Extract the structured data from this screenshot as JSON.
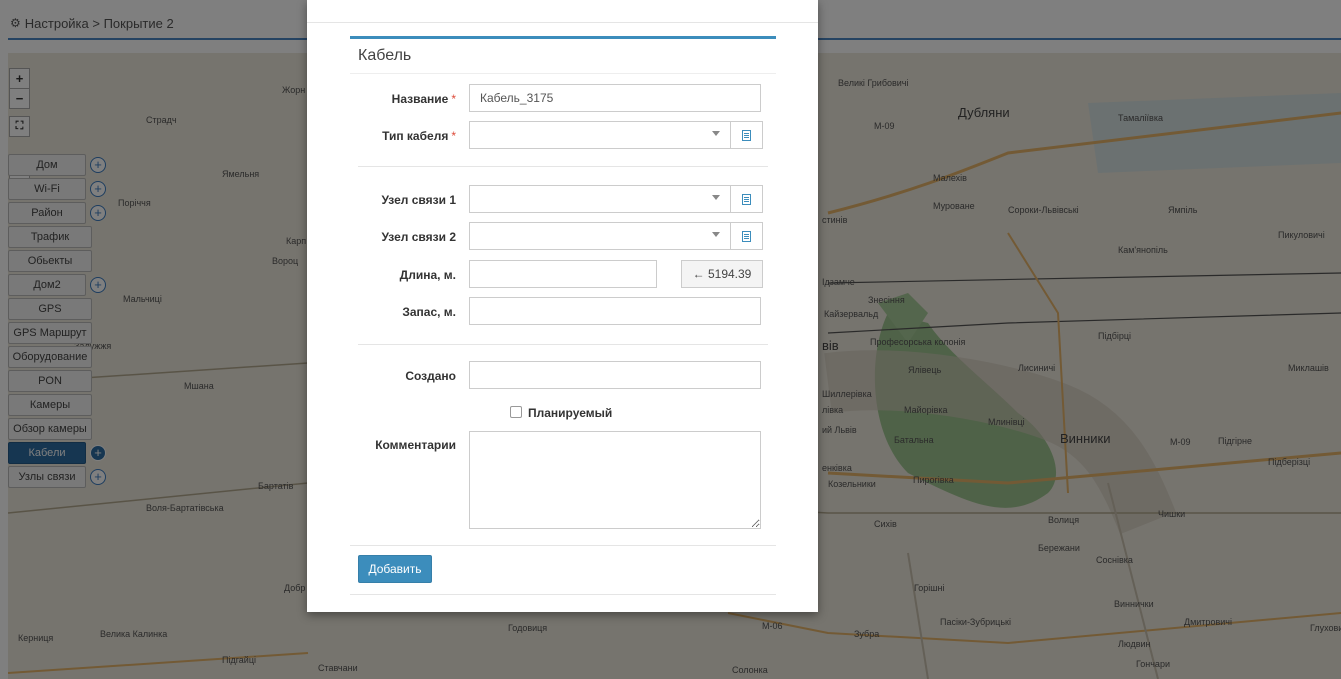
{
  "topbar": {
    "breadcrumb": "Настройка > Покрытие 2"
  },
  "map": {
    "zoom_in": "+",
    "zoom_out": "−",
    "fullscreen": "⛶",
    "collapse": "−",
    "labels": {
      "dublyany": "Дубляни",
      "velyki_hrybovychi": "Великі Грибовичі",
      "tamalivka": "Тамаліївка",
      "m09_top": "М-09",
      "malekhiv": "Малехів",
      "murovane": "Муроване",
      "soroky": "Сороки-Львівські",
      "yampil": "Ямпіль",
      "pykulovychi": "Пикуловичі",
      "kamianopil": "Кам'янопіль",
      "rudamche": "Ідзамче",
      "znesinnia": "Знесіння",
      "kaizervald": "Кайзервальд",
      "profesorska": "Професорська колонія",
      "pidbirtsi": "Підбірці",
      "lysynychi": "Лисиничі",
      "mykolaiv": "Миклашів",
      "yalivets": "Ялівець",
      "shilerivka": "Шиллерівка",
      "mayorivka": "Майорівка",
      "mlynivtsi": "Млинівці",
      "batalna": "Батальна",
      "vynnyky": "Винники",
      "m09": "М-09",
      "pidhirne": "Підгірне",
      "pidberiztsi": "Підберізці",
      "kozelnyky": "Козельники",
      "pyrohivka": "Пирогівка",
      "chyshky": "Чишки",
      "volytsia": "Волиця",
      "sykhiv": "Сихів",
      "berezhany": "Бережани",
      "sosnivka": "Соснівка",
      "horishni": "Горішні",
      "vynnychky": "Виннички",
      "dmytrovychi": "Дмитровичі",
      "pasiky": "Пасіки-Зубрицькі",
      "zubra": "Зубра",
      "liudvyn": "Людвин",
      "honchary": "Гончари",
      "hlukhovychi": "Глухови",
      "stradch": "Страдч",
      "yamelnia": "Ямельня",
      "porichchia": "Поріччя",
      "mylchytsi": "Мальчиці",
      "zaluzhzhia": "Залужжя",
      "mshana": "Мшана",
      "bartativ": "Бартатів",
      "volia_bartativska": "Воля-Бартатівська",
      "kernytsia": "Керниця",
      "velyka_kalynka": "Велика Калинка",
      "pidhaitsi": "Підгайці",
      "stavchany": "Ставчани",
      "hodovytsia": "Годовиця",
      "m06": "М-06",
      "solonka": "Солонка",
      "zhorny": "Жорн",
      "stinyv": "стинів",
      "vis": "вів",
      "livka": "лівка",
      "lviv": "ий Львів",
      "nkivka": "енківка",
      "karpa": "Карп",
      "voroptsi": "Вороц",
      "dobr": "Добр"
    }
  },
  "layers": [
    {
      "label": "Дом",
      "plus": true,
      "active": false
    },
    {
      "label": "Wi-Fi",
      "plus": true,
      "active": false
    },
    {
      "label": "Район",
      "plus": true,
      "active": false
    },
    {
      "label": "Трафик",
      "plus": false,
      "active": false
    },
    {
      "label": "Обьекты",
      "plus": false,
      "active": false
    },
    {
      "label": "Дом2",
      "plus": true,
      "active": false
    },
    {
      "label": "GPS",
      "plus": false,
      "active": false
    },
    {
      "label": "GPS Маршрут",
      "plus": false,
      "active": false
    },
    {
      "label": "Оборудование",
      "plus": false,
      "active": false
    },
    {
      "label": "PON",
      "plus": false,
      "active": false
    },
    {
      "label": "Камеры",
      "plus": false,
      "active": false
    },
    {
      "label": "Обзор камеры",
      "plus": false,
      "active": false
    },
    {
      "label": "Кабели",
      "plus": true,
      "active": true
    },
    {
      "label": "Узлы связи",
      "plus": true,
      "active": false
    }
  ],
  "form": {
    "title": "Кабель",
    "name_label": "Название",
    "name_value": "Кабель_3175",
    "cable_type_label": "Тип кабеля",
    "required_mark": "*",
    "node1_label": "Узел связи 1",
    "node2_label": "Узел связи 2",
    "length_label": "Длина, м.",
    "length_button": "← 5194.39",
    "reserve_label": "Запас, м.",
    "created_label": "Создано",
    "planned_label": "Планируемый",
    "comments_label": "Комментарии",
    "submit_label": "Добавить"
  }
}
